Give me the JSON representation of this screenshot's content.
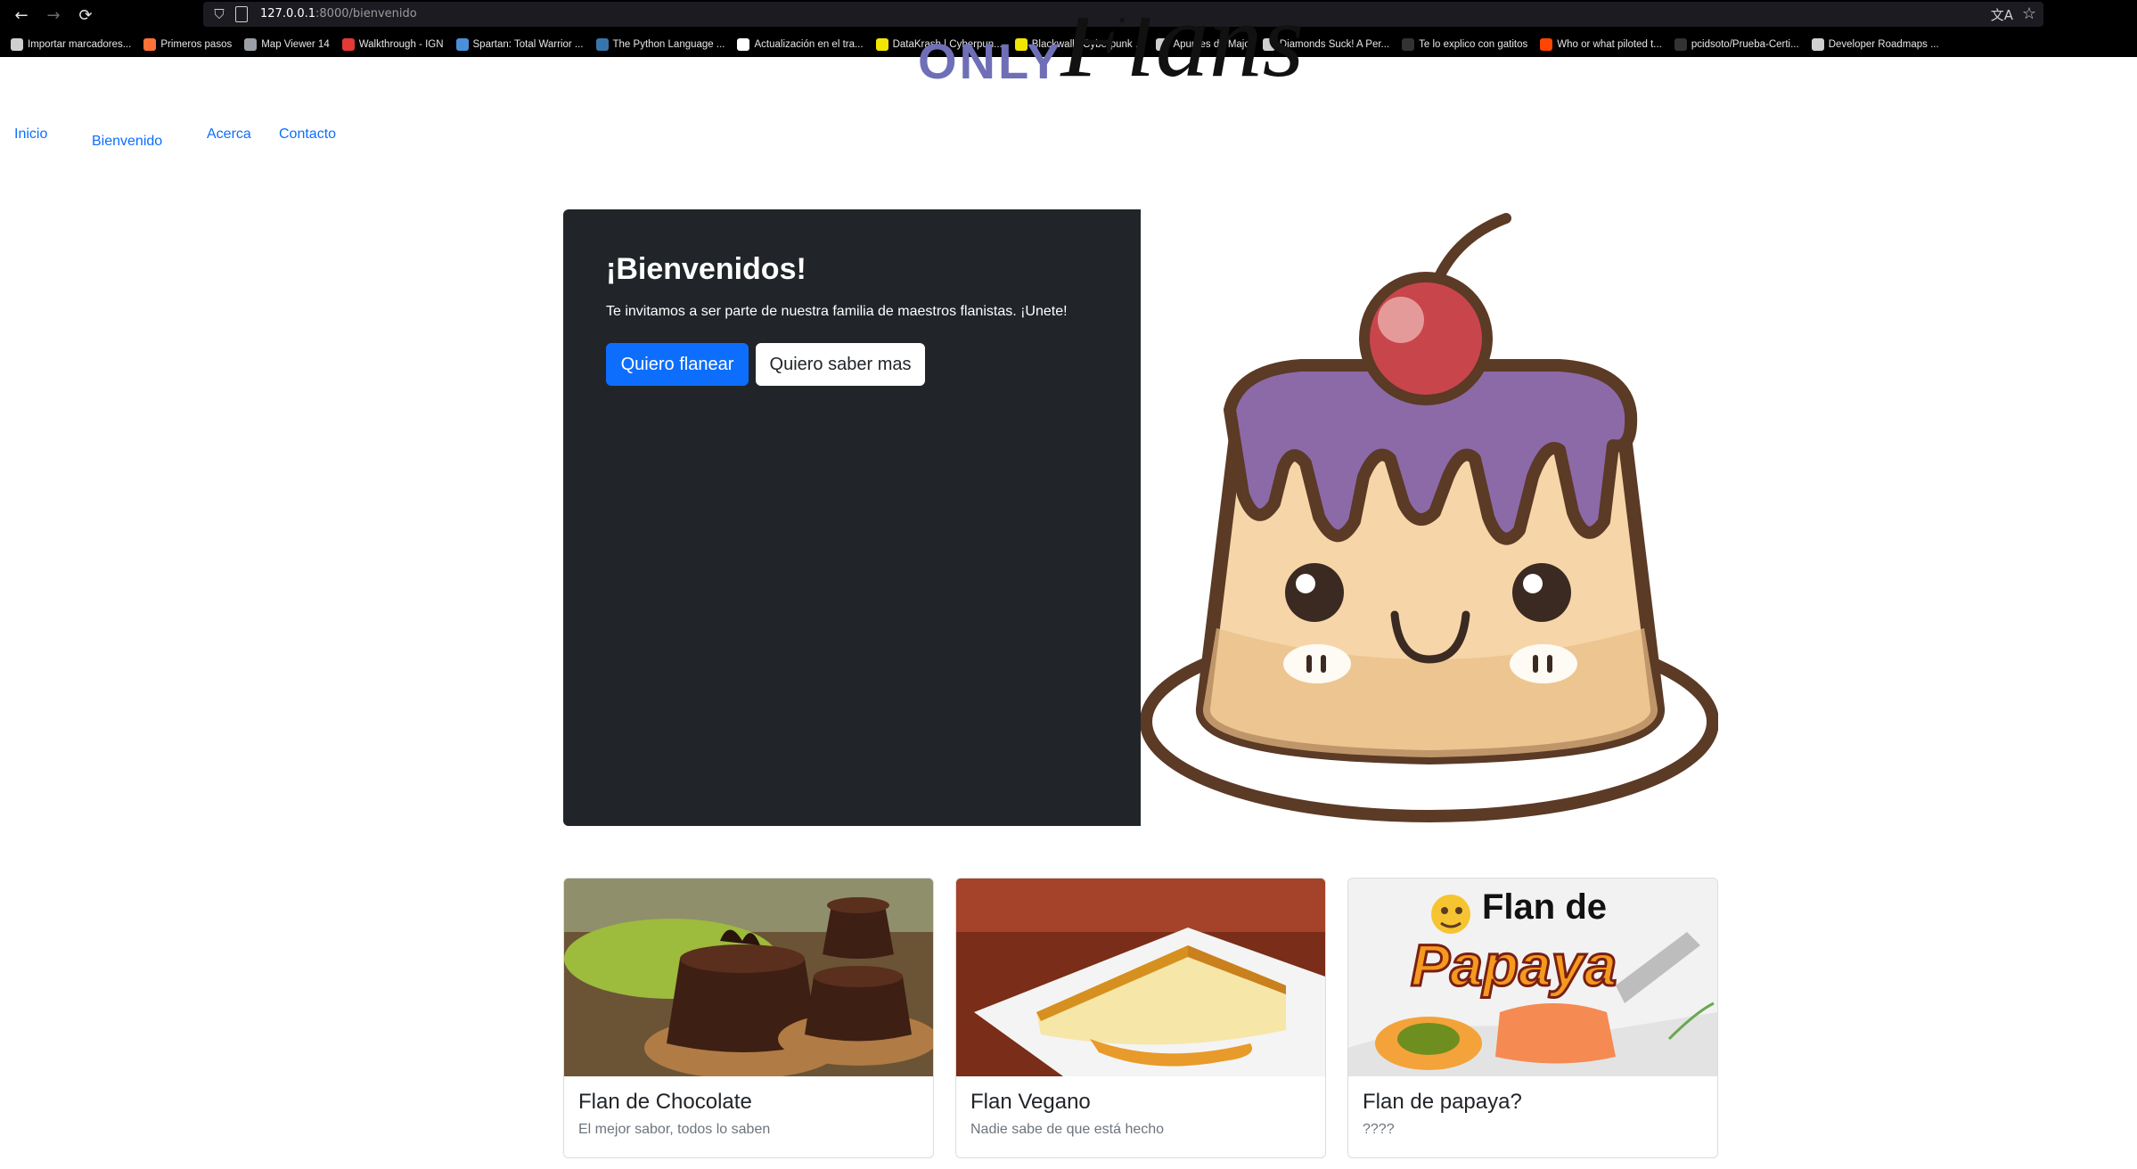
{
  "browser": {
    "url_host": "127.0.0.1",
    "url_path": ":8000/bienvenido",
    "bookmarks": [
      {
        "label": "Importar marcadores...",
        "color": "#cfcfcf"
      },
      {
        "label": "Primeros pasos",
        "color": "#ff7139"
      },
      {
        "label": "Map Viewer 14",
        "color": "#9aa0a6"
      },
      {
        "label": "Walkthrough - IGN",
        "color": "#e53935"
      },
      {
        "label": "Spartan: Total Warrior ...",
        "color": "#4a90d9"
      },
      {
        "label": "The Python Language ...",
        "color": "#3776ab"
      },
      {
        "label": "Actualización en el tra...",
        "color": "#ffffff"
      },
      {
        "label": "DataKrash | Cyberpun...",
        "color": "#f2e600"
      },
      {
        "label": "Blackwall | Cyberpunk ...",
        "color": "#f2e600"
      },
      {
        "label": "Apuntes de Majo",
        "color": "#cfcfcf"
      },
      {
        "label": "Diamonds Suck! A Per...",
        "color": "#cfcfcf"
      },
      {
        "label": "Te lo explico con gatitos",
        "color": "#333333"
      },
      {
        "label": "Who or what piloted t...",
        "color": "#ff4500"
      },
      {
        "label": "pcidsoto/Prueba-Certi...",
        "color": "#333333"
      },
      {
        "label": "Developer Roadmaps ...",
        "color": "#cfcfcf"
      }
    ]
  },
  "logo": {
    "word1": "ONLY",
    "word2": "Flans"
  },
  "nav": {
    "items": [
      "Inicio",
      "Bienvenido",
      "Acerca",
      "Contacto"
    ],
    "color": "#0d6efd"
  },
  "hero": {
    "title": "¡Bienvenidos!",
    "text": "Te invitamos a ser parte de nuestra familia de maestros flanistas. ¡Unete!",
    "primary_button": "Quiero flanear",
    "secondary_button": "Quiero saber mas",
    "image_label": "cute-flan-illustration"
  },
  "cards": [
    {
      "title": "Flan de Chocolate",
      "text": "El mejor sabor, todos lo saben"
    },
    {
      "title": "Flan Vegano",
      "text": "Nadie sabe de que está hecho"
    },
    {
      "title": "Flan de papaya?",
      "text": "????",
      "image_caption": "Flan de Papaya"
    }
  ]
}
